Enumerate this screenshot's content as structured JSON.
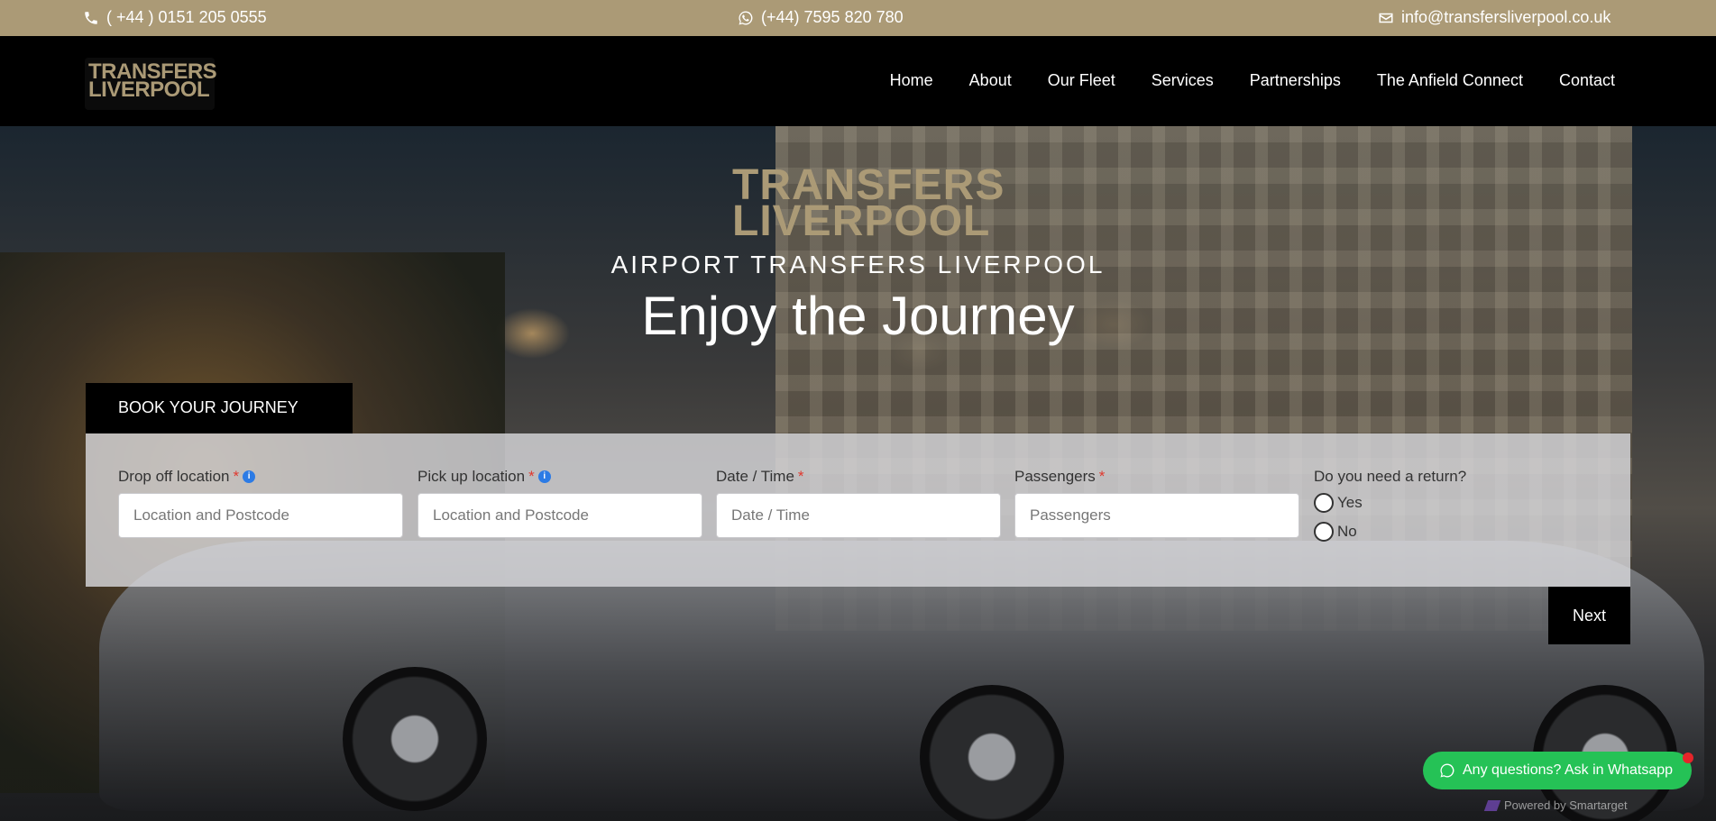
{
  "topbar": {
    "phone": "( +44 ) 0151 205 0555",
    "whatsapp": "(+44) 7595 820 780",
    "email": "info@transfersliverpool.co.uk",
    "phone_icon": "phone-icon",
    "whatsapp_icon": "whatsapp-icon",
    "email_icon": "envelope-icon"
  },
  "logo": {
    "line1": "TRANSFERS",
    "line2": "LIVERPOOL"
  },
  "nav": {
    "items": [
      "Home",
      "About",
      "Our Fleet",
      "Services",
      "Partnerships",
      "The Anfield Connect",
      "Contact"
    ]
  },
  "hero": {
    "subtitle": "AIRPORT TRANSFERS LIVERPOOL",
    "headline": "Enjoy the Journey"
  },
  "booking": {
    "tab_label": "BOOK YOUR JOURNEY",
    "required_mark": "*",
    "info_glyph": "i",
    "dropoff": {
      "label": "Drop off location",
      "placeholder": "Location and Postcode"
    },
    "pickup": {
      "label": "Pick up location",
      "placeholder": "Location and Postcode"
    },
    "datetime": {
      "label": "Date / Time",
      "placeholder": "Date / Time"
    },
    "passengers": {
      "label": "Passengers",
      "placeholder": "Passengers"
    },
    "return": {
      "label": "Do you need a return?",
      "yes": "Yes",
      "no": "No"
    },
    "next_label": "Next"
  },
  "widget": {
    "whatsapp_label": "Any questions? Ask in Whatsapp",
    "powered_by": "Powered by Smartarget"
  },
  "colors": {
    "gold": "#ab9a76",
    "black": "#000000",
    "whatsapp_green": "#25c256",
    "required_red": "#e0382e",
    "info_blue": "#2c7be5"
  }
}
